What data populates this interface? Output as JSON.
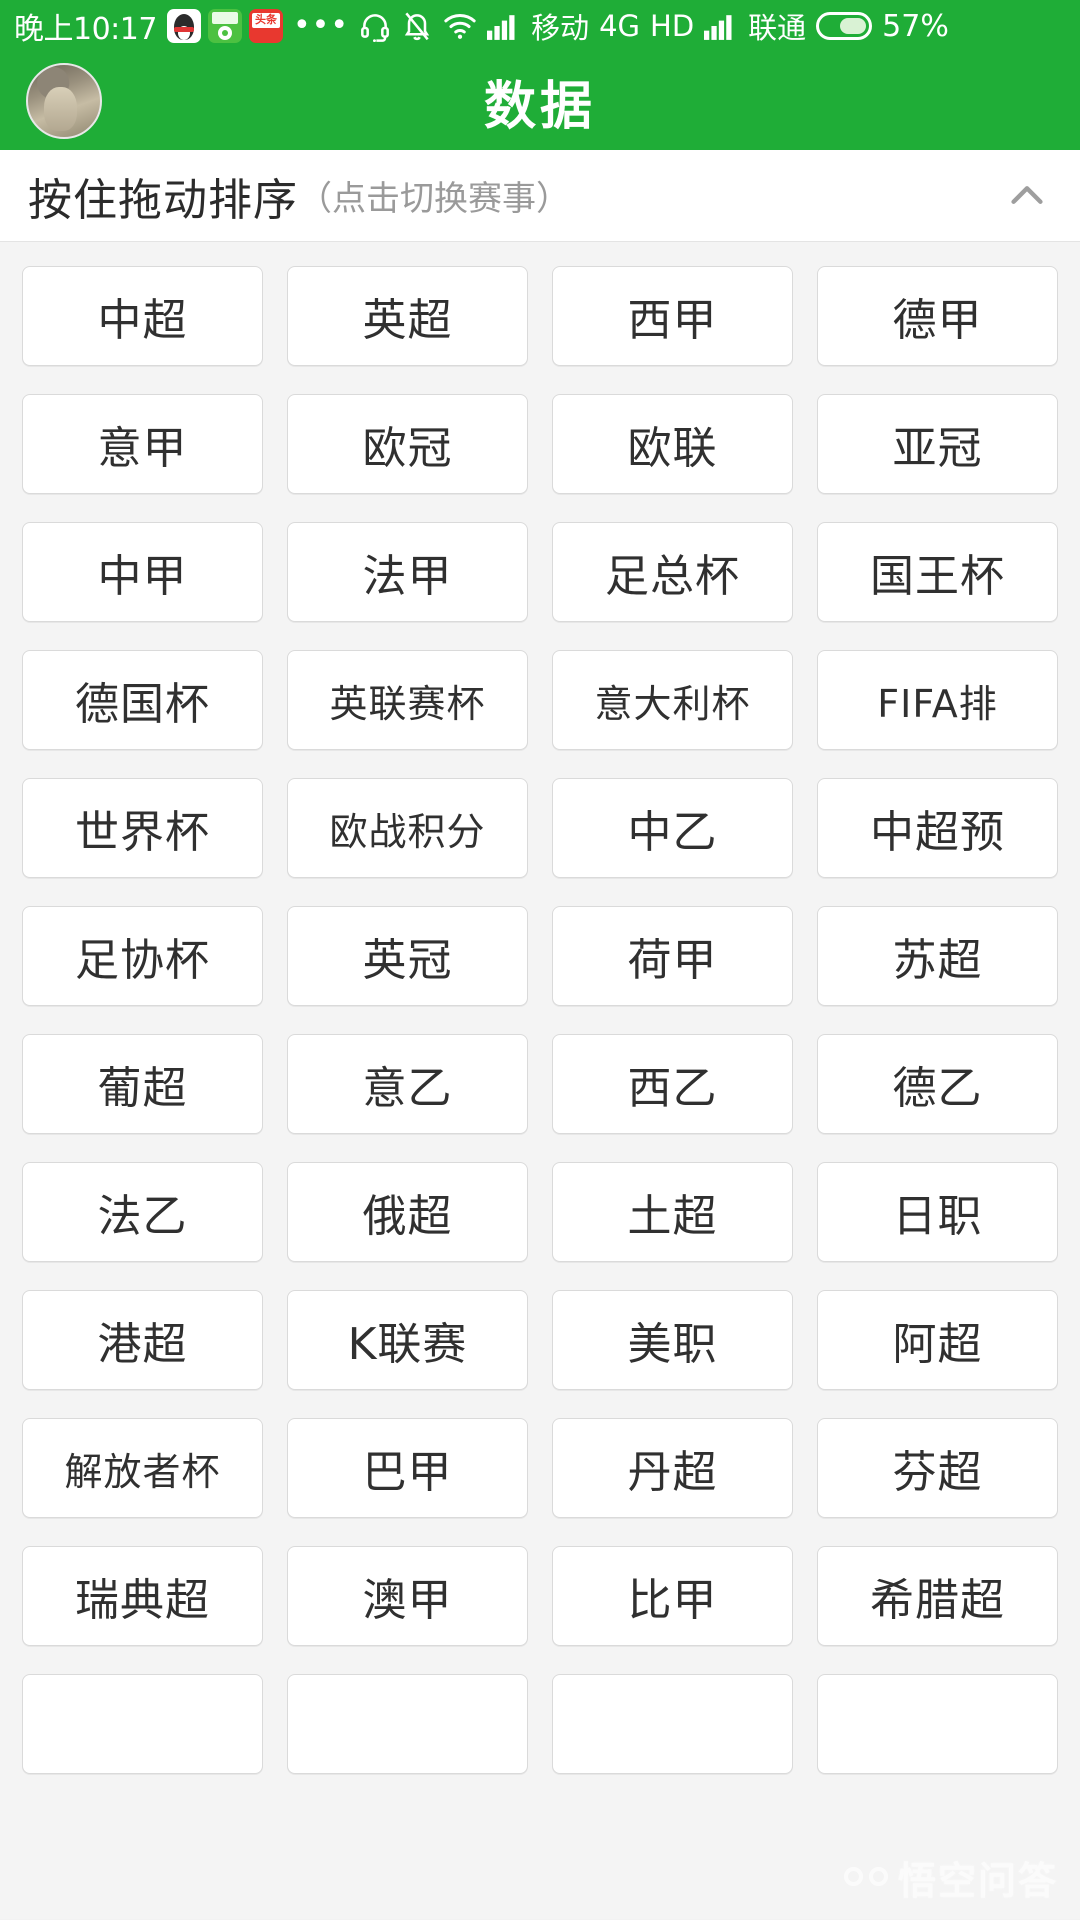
{
  "status_bar": {
    "time": "晚上10:17",
    "app_icons": [
      "qq-icon",
      "football-app-icon",
      "toutiao-icon"
    ],
    "overflow_dots": "•••",
    "icons": [
      "headset-icon",
      "bell-muted-icon",
      "wifi-icon",
      "signal-bars-icon"
    ],
    "carrier_primary": "移动",
    "network_type": "4G",
    "hd_label": "HD",
    "carrier_secondary": "联通",
    "battery_percent": "57%"
  },
  "app_bar": {
    "title": "数据",
    "avatar": "user-avatar"
  },
  "section": {
    "title": "按住拖动排序",
    "hint": "（点击切换赛事）",
    "collapse_icon": "chevron-up-icon"
  },
  "grid": {
    "columns": 4,
    "items": [
      "中超",
      "英超",
      "西甲",
      "德甲",
      "意甲",
      "欧冠",
      "欧联",
      "亚冠",
      "中甲",
      "法甲",
      "足总杯",
      "国王杯",
      "德国杯",
      "英联赛杯",
      "意大利杯",
      "FIFA排",
      "世界杯",
      "欧战积分",
      "中乙",
      "中超预",
      "足协杯",
      "英冠",
      "荷甲",
      "苏超",
      "葡超",
      "意乙",
      "西乙",
      "德乙",
      "法乙",
      "俄超",
      "土超",
      "日职",
      "港超",
      "K联赛",
      "美职",
      "阿超",
      "解放者杯",
      "巴甲",
      "丹超",
      "芬超",
      "瑞典超",
      "澳甲",
      "比甲",
      "希腊超",
      "",
      "",
      "",
      ""
    ]
  },
  "watermark": {
    "text": "悟空问答",
    "logo": "wukong-logo"
  },
  "colors": {
    "brand_green": "#1FAD37",
    "page_bg": "#f4f4f4",
    "tile_bg": "#ffffff",
    "tile_border": "#dadada",
    "text_primary": "#303030",
    "text_muted": "#9a9a9a"
  }
}
